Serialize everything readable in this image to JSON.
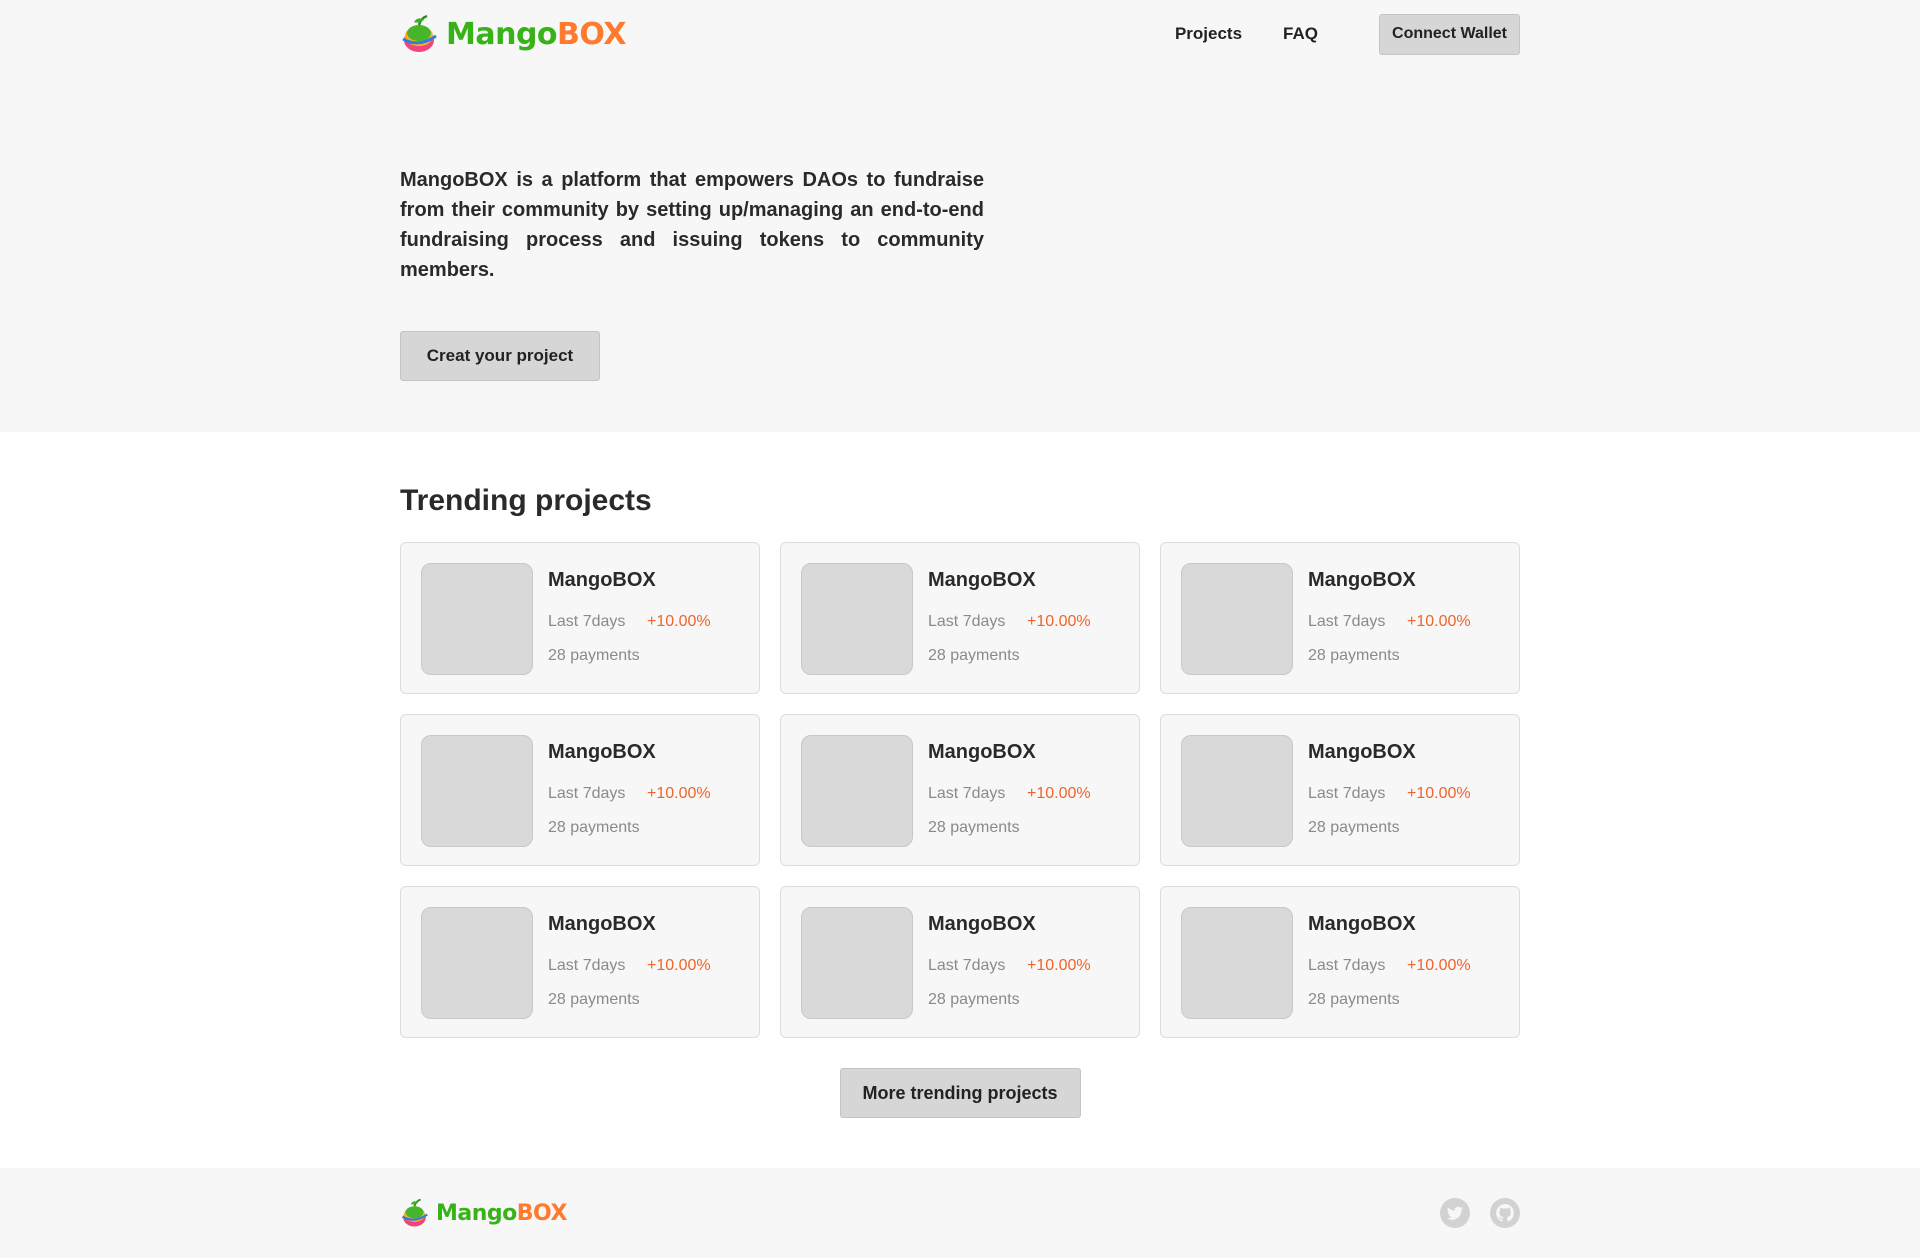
{
  "brand": {
    "name_part1": "Mango",
    "name_part2": "BOX",
    "color_primary": "#38b219",
    "color_accent": "#ff7a2f"
  },
  "header": {
    "nav": [
      {
        "label": "Projects"
      },
      {
        "label": "FAQ"
      }
    ],
    "connect_wallet_label": "Connect Wallet"
  },
  "hero": {
    "description": "MangoBOX is a platform that empowers DAOs to fundraise from their community by setting up/managing an end-to-end fundraising process and issuing tokens to community members.",
    "create_button_label": "Creat your project"
  },
  "trending": {
    "title": "Trending projects",
    "projects": [
      {
        "name": "MangoBOX",
        "period": "Last 7days",
        "change": "+10.00%",
        "payments": "28 payments"
      },
      {
        "name": "MangoBOX",
        "period": "Last 7days",
        "change": "+10.00%",
        "payments": "28 payments"
      },
      {
        "name": "MangoBOX",
        "period": "Last 7days",
        "change": "+10.00%",
        "payments": "28 payments"
      },
      {
        "name": "MangoBOX",
        "period": "Last 7days",
        "change": "+10.00%",
        "payments": "28 payments"
      },
      {
        "name": "MangoBOX",
        "period": "Last 7days",
        "change": "+10.00%",
        "payments": "28 payments"
      },
      {
        "name": "MangoBOX",
        "period": "Last 7days",
        "change": "+10.00%",
        "payments": "28 payments"
      },
      {
        "name": "MangoBOX",
        "period": "Last 7days",
        "change": "+10.00%",
        "payments": "28 payments"
      },
      {
        "name": "MangoBOX",
        "period": "Last 7days",
        "change": "+10.00%",
        "payments": "28 payments"
      },
      {
        "name": "MangoBOX",
        "period": "Last 7days",
        "change": "+10.00%",
        "payments": "28 payments"
      }
    ],
    "more_button_label": "More trending projects"
  },
  "footer": {
    "social": [
      {
        "icon": "twitter-icon"
      },
      {
        "icon": "github-icon"
      }
    ]
  }
}
